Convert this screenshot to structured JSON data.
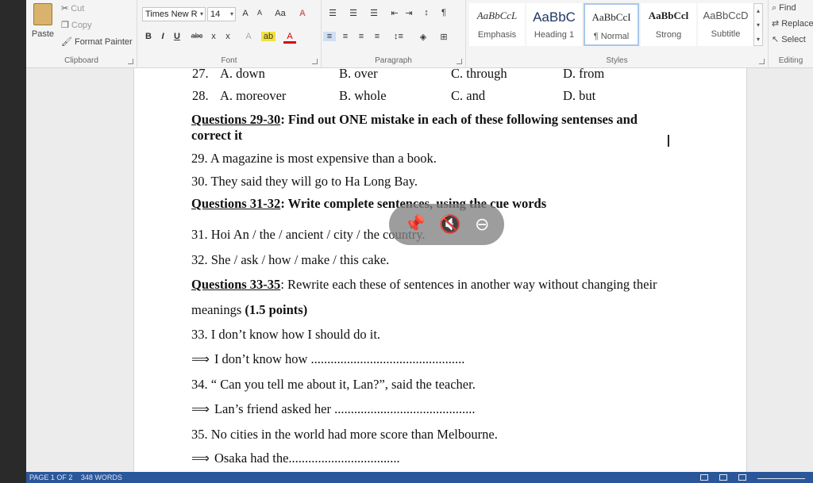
{
  "ribbon": {
    "clipboard": {
      "paste": "Paste",
      "cut": "Cut",
      "copy": "Copy",
      "format_painter": "Format Painter",
      "label": "Clipboard"
    },
    "font": {
      "name": "Times New R",
      "size": "14",
      "label": "Font",
      "grow": "A",
      "shrink": "A",
      "case": "Aa",
      "bold": "B",
      "italic": "I",
      "underline": "U",
      "strike": "abc",
      "sub": "x",
      "sup": "x",
      "color_a": "A"
    },
    "paragraph": {
      "label": "Paragraph",
      "pilcrow": "¶"
    },
    "styles": {
      "label": "Styles",
      "tiles": [
        {
          "preview": "AaBbCcL",
          "name": "Emphasis"
        },
        {
          "preview": "AaBbC",
          "name": "Heading 1"
        },
        {
          "preview": "AaBbCcI",
          "name": "¶ Normal"
        },
        {
          "preview": "AaBbCcl",
          "name": "Strong"
        },
        {
          "preview": "AaBbCcD",
          "name": "Subtitle"
        }
      ]
    },
    "editing": {
      "find": "Find",
      "replace": "Replace",
      "select": "Select",
      "label": "Editing"
    }
  },
  "doc": {
    "q27": {
      "num": "27.",
      "a": "A. down",
      "b": "B. over",
      "c": "C. through",
      "d": "D. from"
    },
    "q28": {
      "num": "28.",
      "a": "A. moreover",
      "b": "B. whole",
      "c": "C. and",
      "d": "D. but"
    },
    "h2930_title": "Questions 29-30",
    "h2930_rest": ": Find out ONE mistake in each of these following sentenses and",
    "h2930_cont": "correct it",
    "q29": "29. A magazine is most expensive than a book.",
    "q30": "30.  They said they will go to Ha Long Bay.",
    "h3132_title": "Questions 31-32",
    "h3132_rest": ":  Write complete sentences, using the cue words",
    "q31": "31. Hoi An / the / ancient / city / the country.",
    "q32": "32. She / ask / how / make / this cake.",
    "h3335_title": "Questions 33-35",
    "h3335_rest": ": Rewrite each these of sentences in another way without changing their",
    "h3335_cont": "meanings ",
    "h3335_points": "(1.5 points)",
    "q33": "33. I don’t know how I should do it.",
    "a33": "I don’t know how ...............................................",
    "q34": "34. “ Can you tell me about it, Lan?”, said the teacher.",
    "a34": "Lan’s friend asked her ...........................................",
    "q35": "35.  No cities in the world had more score than Melbourne.",
    "a35": "Osaka had the.................................."
  },
  "status": {
    "page": "PAGE 1 OF 2",
    "words": "348 WORDS"
  }
}
